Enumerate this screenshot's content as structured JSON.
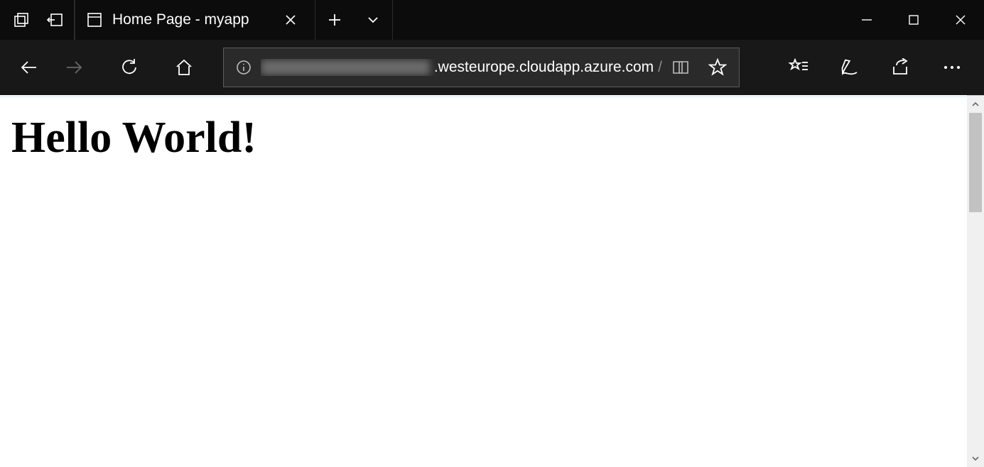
{
  "titlebar": {
    "tab_title": "Home Page - myapp"
  },
  "addressbar": {
    "host_blurred": "xxxxxxxxxxxx",
    "host_visible": ".westeurope.cloudapp.azure.com",
    "path": "/"
  },
  "page": {
    "heading": "Hello World!"
  }
}
